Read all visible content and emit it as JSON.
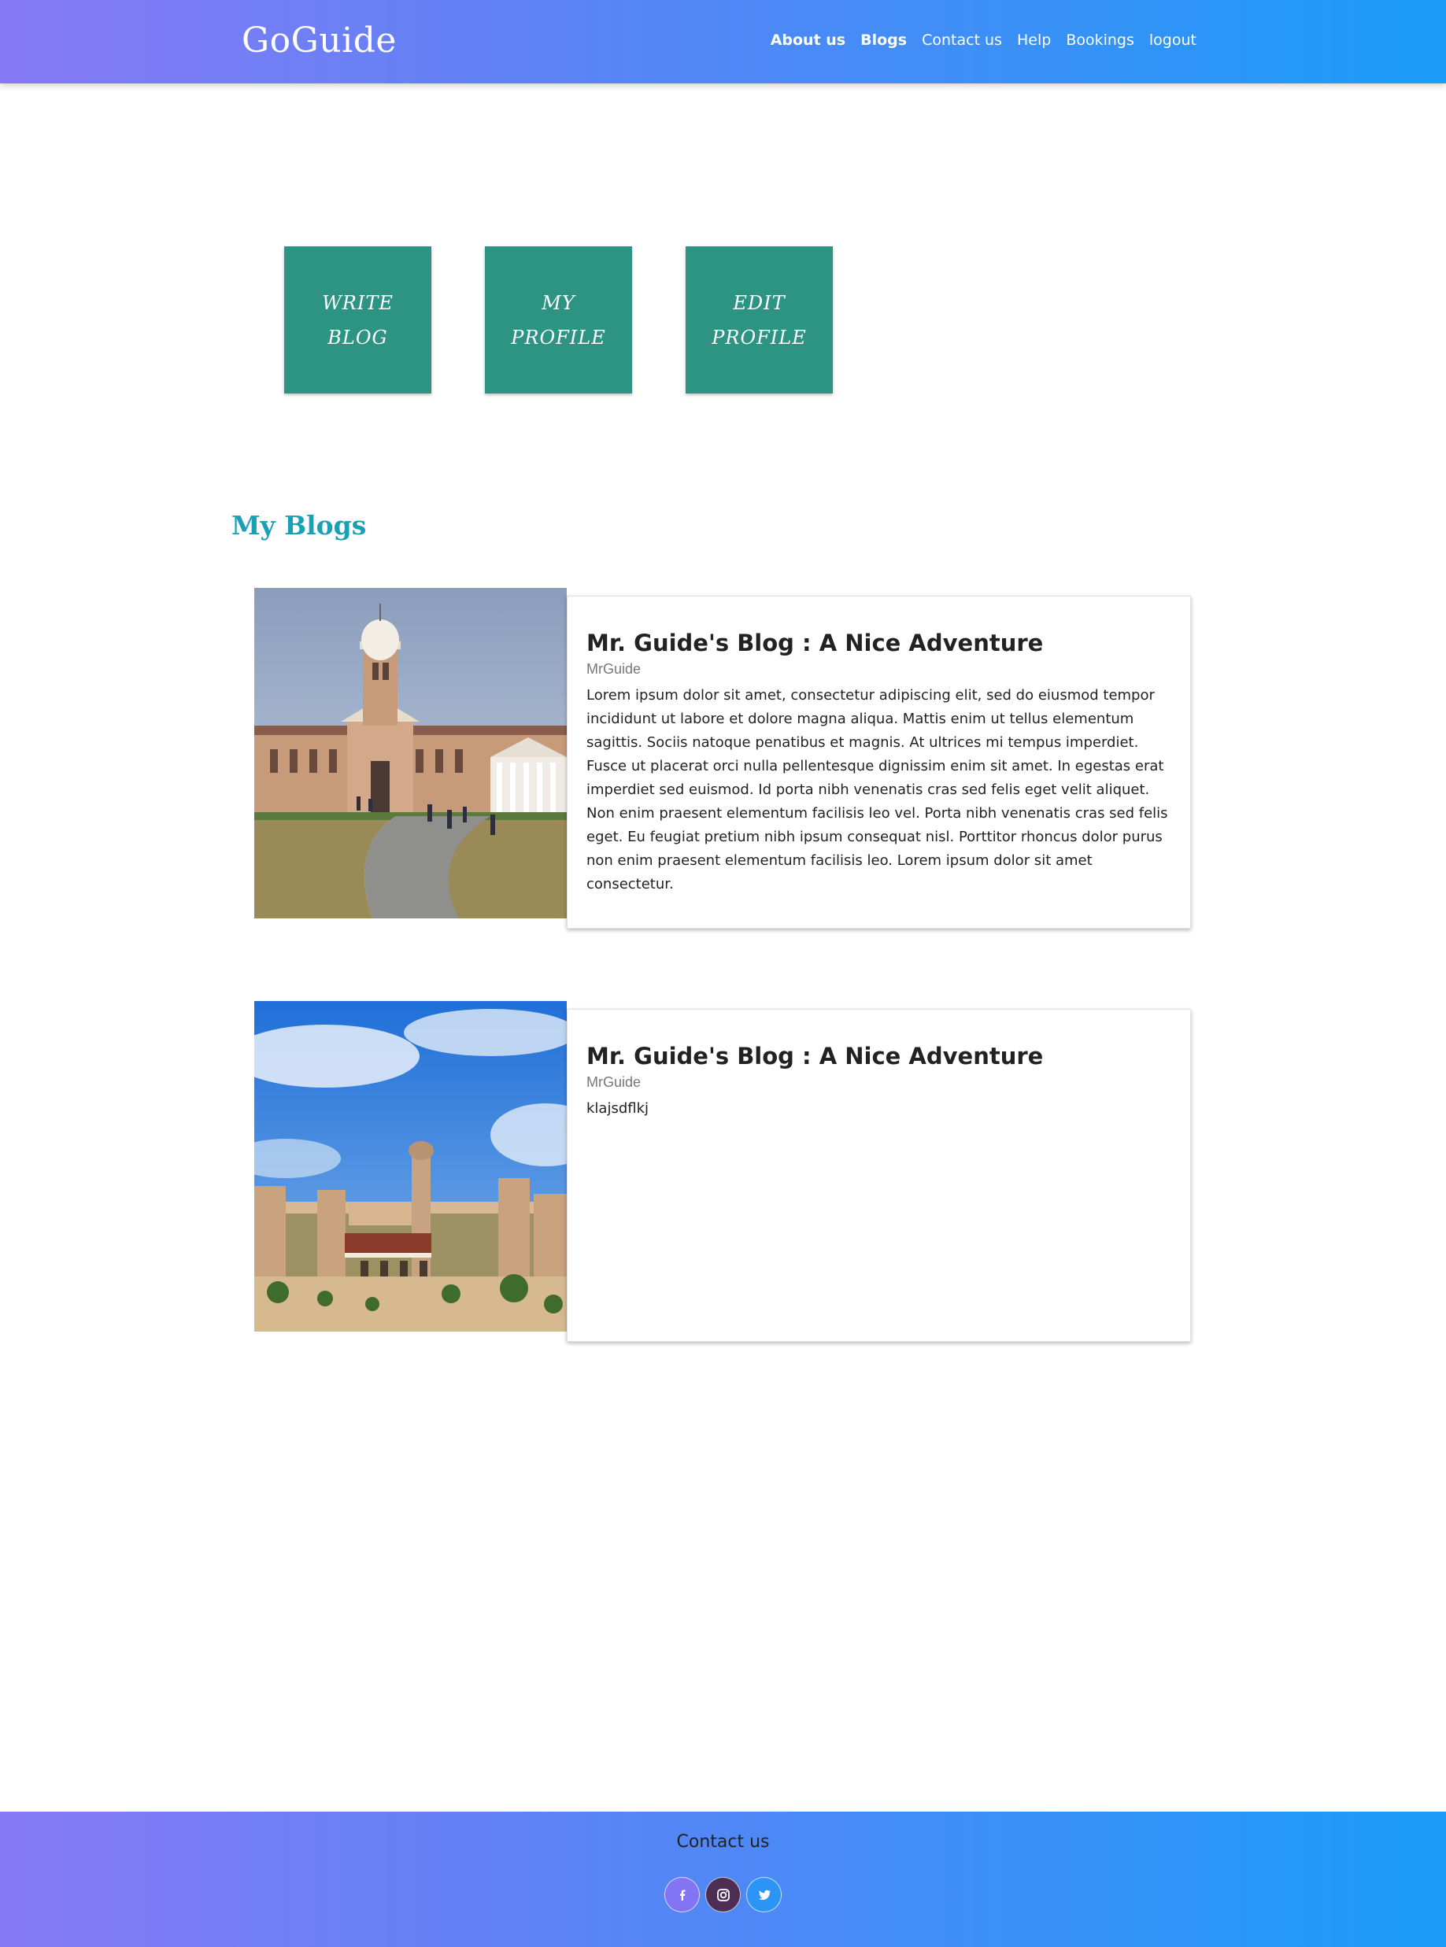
{
  "header": {
    "brand": "GoGuide",
    "nav": [
      "About us",
      "Blogs",
      "Contact us",
      "Help",
      "Bookings",
      "logout"
    ]
  },
  "tiles": {
    "write_blog": "WRITE\nBLOG",
    "my_profile": "MY\nPROFILE",
    "edit_profile": "EDIT\nPROFILE"
  },
  "section_title": "My Blogs",
  "blogs": [
    {
      "title": "Mr. Guide's Blog : A Nice Adventure",
      "author": "MrGuide",
      "body": "Lorem ipsum dolor sit amet, consectetur adipiscing elit, sed do eiusmod tempor incididunt ut labore et dolore magna aliqua. Mattis enim ut tellus elementum sagittis. Sociis natoque penatibus et magnis. At ultrices mi tempus imperdiet. Fusce ut placerat orci nulla pellentesque dignissim enim sit amet. In egestas erat imperdiet sed euismod. Id porta nibh venenatis cras sed felis eget velit aliquet. Non enim praesent elementum facilisis leo vel. Porta nibh venenatis cras sed felis eget. Eu feugiat pretium nibh ipsum consequat nisl. Porttitor rhoncus dolor purus non enim praesent elementum facilisis leo. Lorem ipsum dolor sit amet consectetur."
    },
    {
      "title": "Mr. Guide's Blog : A Nice Adventure",
      "author": "MrGuide",
      "body": "klajsdflkj"
    }
  ],
  "footer": {
    "title": "Contact us",
    "socials": [
      "facebook-icon",
      "instagram-icon",
      "twitter-icon"
    ]
  }
}
